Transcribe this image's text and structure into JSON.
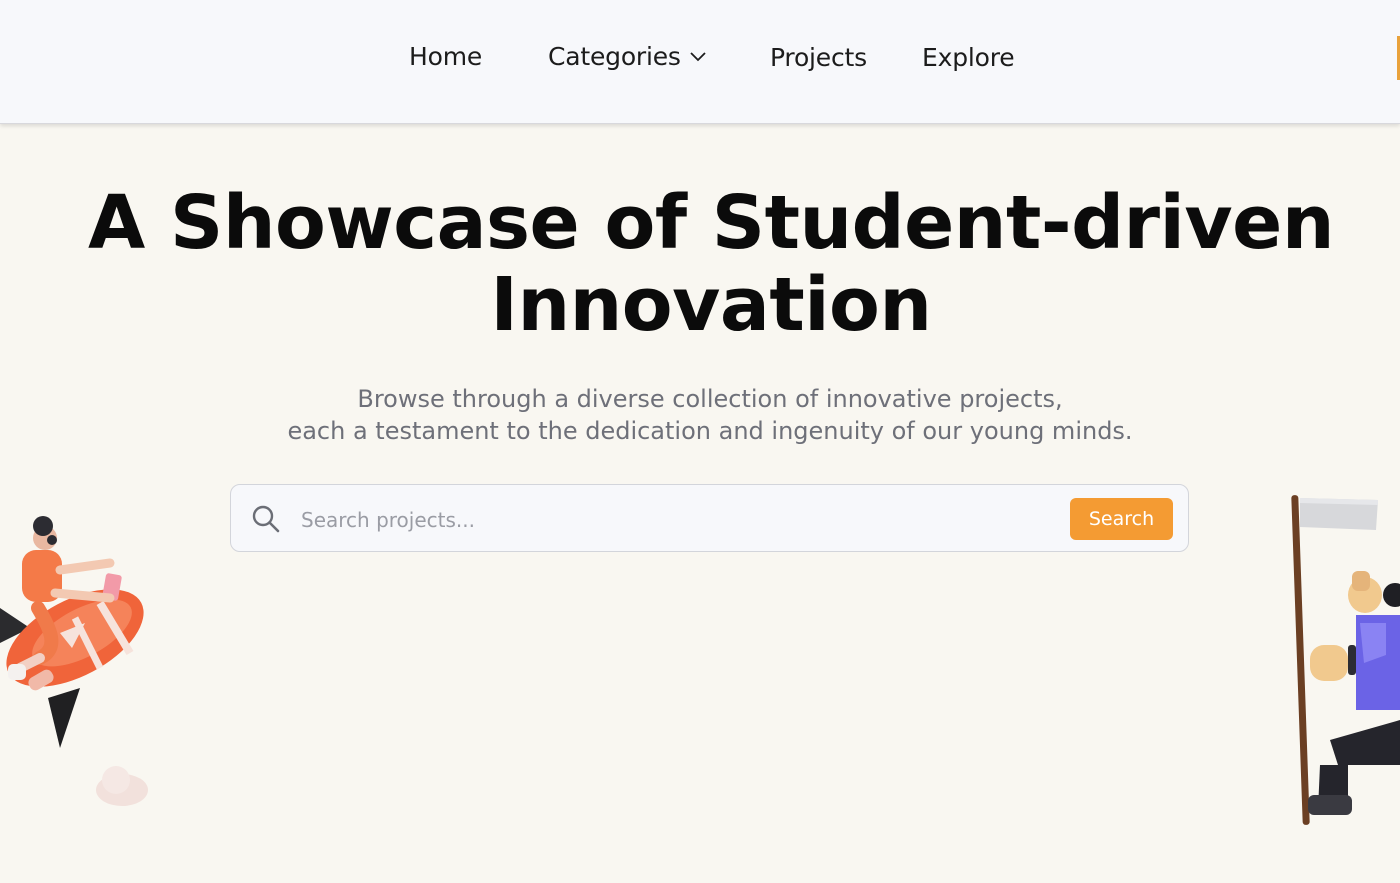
{
  "nav": {
    "items": [
      {
        "label": "Home"
      },
      {
        "label": "Categories"
      },
      {
        "label": "Projects"
      },
      {
        "label": "Explore"
      }
    ]
  },
  "hero": {
    "title_line1": "A Showcase of Student-driven",
    "title_line2": "Innovation",
    "subtitle_line1": "Browse through a diverse collection of innovative projects,",
    "subtitle_line2": "each a testament to the dedication and ingenuity of our young minds."
  },
  "search": {
    "placeholder": "Search projects...",
    "button_label": "Search",
    "icon": "search-icon"
  },
  "illustrations": {
    "left": "rocket-rider-illustration",
    "right": "flag-bearer-illustration"
  },
  "colors": {
    "background": "#f9f7f1",
    "nav_background": "#f7f8fb",
    "accent": "#f49b33",
    "title": "#0b0b0b",
    "subtitle": "#6e7079"
  }
}
